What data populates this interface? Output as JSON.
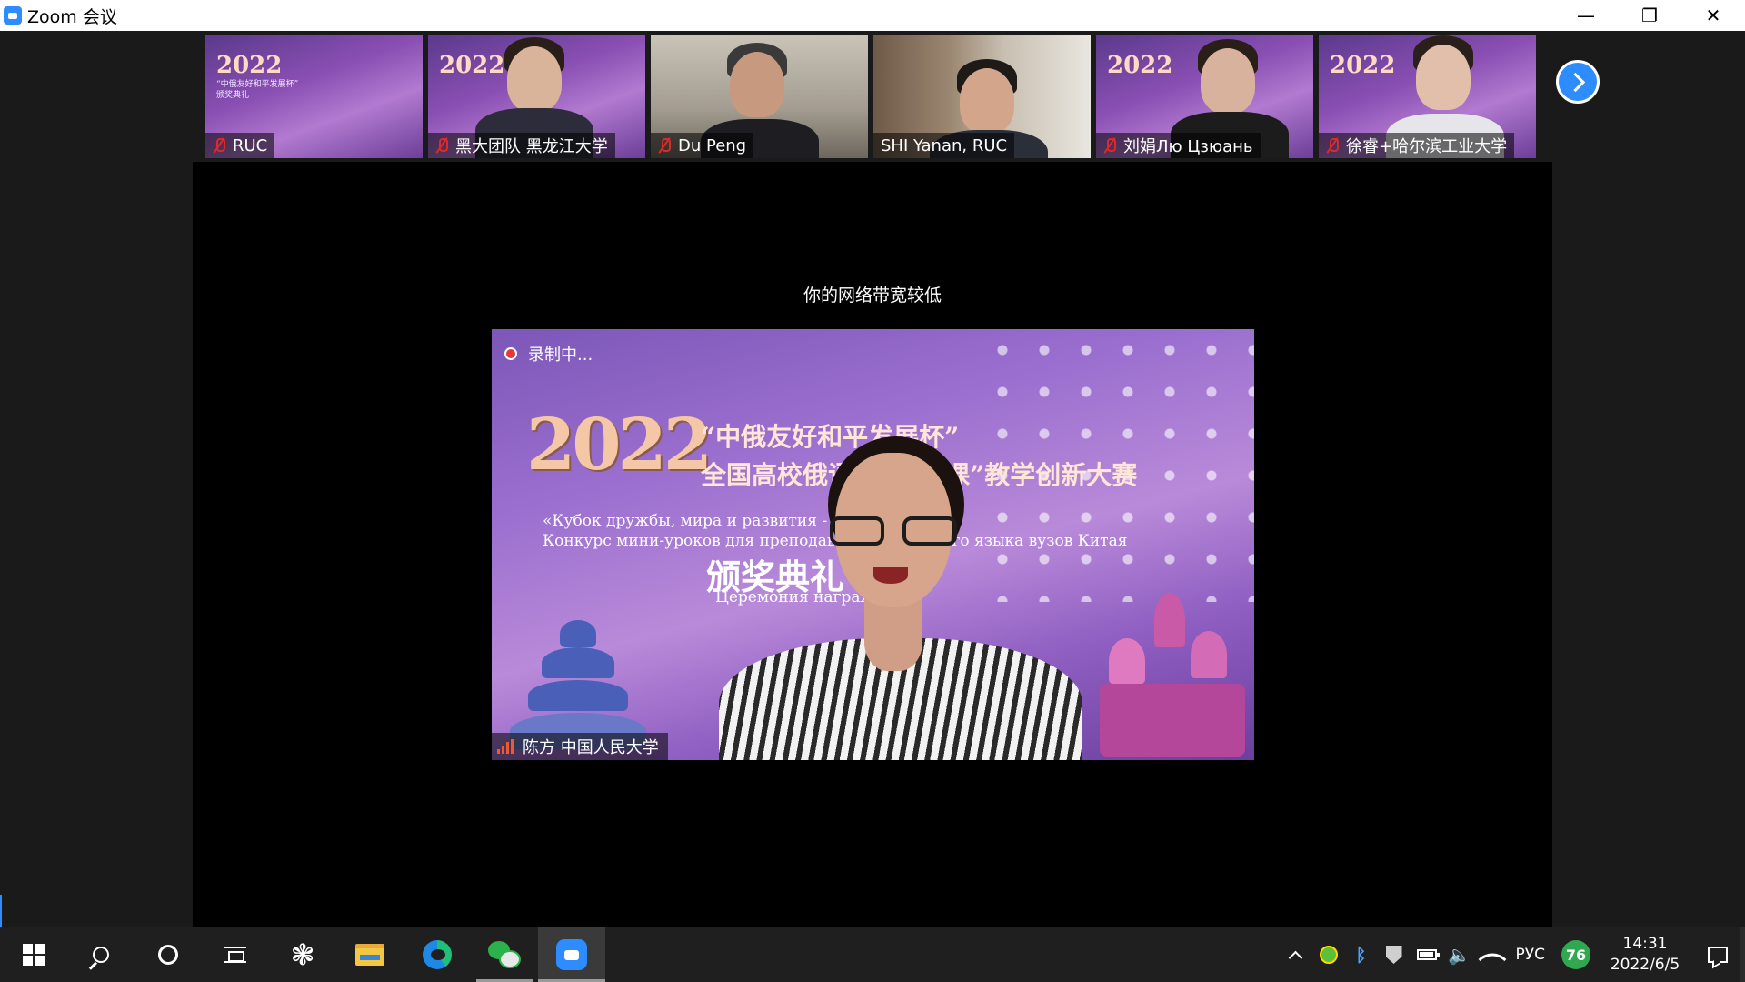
{
  "window": {
    "title": "Zoom 会议",
    "controls": {
      "minimize": "—",
      "restore": "❐",
      "close": "✕"
    }
  },
  "participants": [
    {
      "name": "RUC",
      "mic": "muted",
      "video": "ceremony-background"
    },
    {
      "name": "黑大团队 黑龙江大学",
      "mic": "muted",
      "video": "ceremony-background"
    },
    {
      "name": "Du Peng",
      "mic": "muted",
      "video": "office"
    },
    {
      "name": "SHI Yanan, RUC",
      "mic": "on",
      "video": "bookshelf"
    },
    {
      "name": "刘娟Лю Цзюань",
      "mic": "muted",
      "video": "ceremony-background"
    },
    {
      "name": "徐睿+哈尔滨工业大学",
      "mic": "muted",
      "video": "ceremony-background"
    }
  ],
  "ceremony_slide": {
    "year": "2022",
    "heading_cn_1": "“中俄友好和平发展杯”",
    "heading_cn_2": "全国高校俄语教育“微课”教学创新大赛",
    "heading_ru_1": "«Кубок дружбы, мира и развития - 2022»",
    "heading_ru_2": "Конкурс мини-уроков для преподавателей русского языка вузов Китая",
    "title_cn": "颁奖典礼",
    "title_ru": "Церемония награждения"
  },
  "main": {
    "notice": "你的网络带宽较低",
    "recording_label": "录制中...",
    "active_speaker": "陈方 中国人民大学"
  },
  "taskbar": {
    "apps": [
      "start",
      "search",
      "cortana",
      "task-view",
      "pinwheel",
      "file-explorer",
      "edge",
      "wechat",
      "zoom"
    ],
    "language": "РУС",
    "badge": "76",
    "time": "14:31",
    "date": "2022/6/5"
  },
  "colors": {
    "zoom_blue": "#2d8cff",
    "muted_red": "#e02828",
    "recording_red": "#e53935"
  }
}
